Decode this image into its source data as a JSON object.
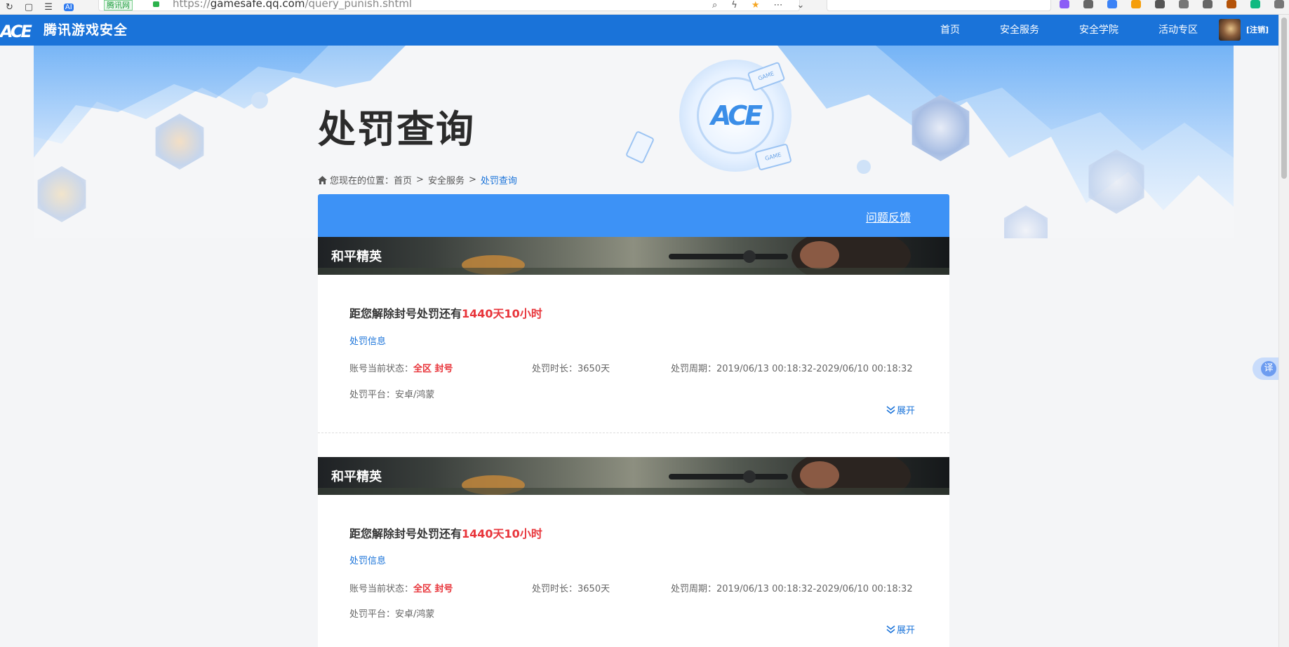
{
  "browser": {
    "site_tag": "腾讯网",
    "url_prefix": "https://",
    "url_domain": "gamesafe.qq.com",
    "url_path": "/query_punish.shtml"
  },
  "nav": {
    "logo_mark": "ACE",
    "logo_text": "腾讯游戏安全",
    "items": [
      "首页",
      "安全服务",
      "安全学院",
      "活动专区"
    ],
    "logout": "[注销]"
  },
  "hero": {
    "emblem": "ACE",
    "chip_label": "GAME",
    "title": "处罚查询"
  },
  "breadcrumb": {
    "prefix": "您现在的位置：",
    "items": [
      "首页",
      "安全服务",
      "处罚查询"
    ],
    "separator": ">"
  },
  "panel": {
    "feedback": "问题反馈"
  },
  "cards": [
    {
      "game": "和平精英",
      "countdown_prefix": "距您解除封号处罚还有",
      "countdown_time": "1440天10小时",
      "section_title": "处罚信息",
      "status_label": "账号当前状态：",
      "status_value": "全区 封号",
      "duration_label": "处罚时长：",
      "duration_value": "3650天",
      "period_label": "处罚周期：",
      "period_value": "2019/06/13 00:18:32-2029/06/10 00:18:32",
      "platform_label": "处罚平台：",
      "platform_value": "安卓/鸿蒙",
      "expand": "展开"
    },
    {
      "game": "和平精英",
      "countdown_prefix": "距您解除封号处罚还有",
      "countdown_time": "1440天10小时",
      "section_title": "处罚信息",
      "status_label": "账号当前状态：",
      "status_value": "全区 封号",
      "duration_label": "处罚时长：",
      "duration_value": "3650天",
      "period_label": "处罚周期：",
      "period_value": "2019/06/13 00:18:32-2029/06/10 00:18:32",
      "platform_label": "处罚平台：",
      "platform_value": "安卓/鸿蒙",
      "expand": "展开"
    }
  ],
  "translate": "译",
  "colors": {
    "nav_blue": "#1a73d9",
    "panel_head_blue": "#3d92f6",
    "alert_red": "#e8353b"
  }
}
